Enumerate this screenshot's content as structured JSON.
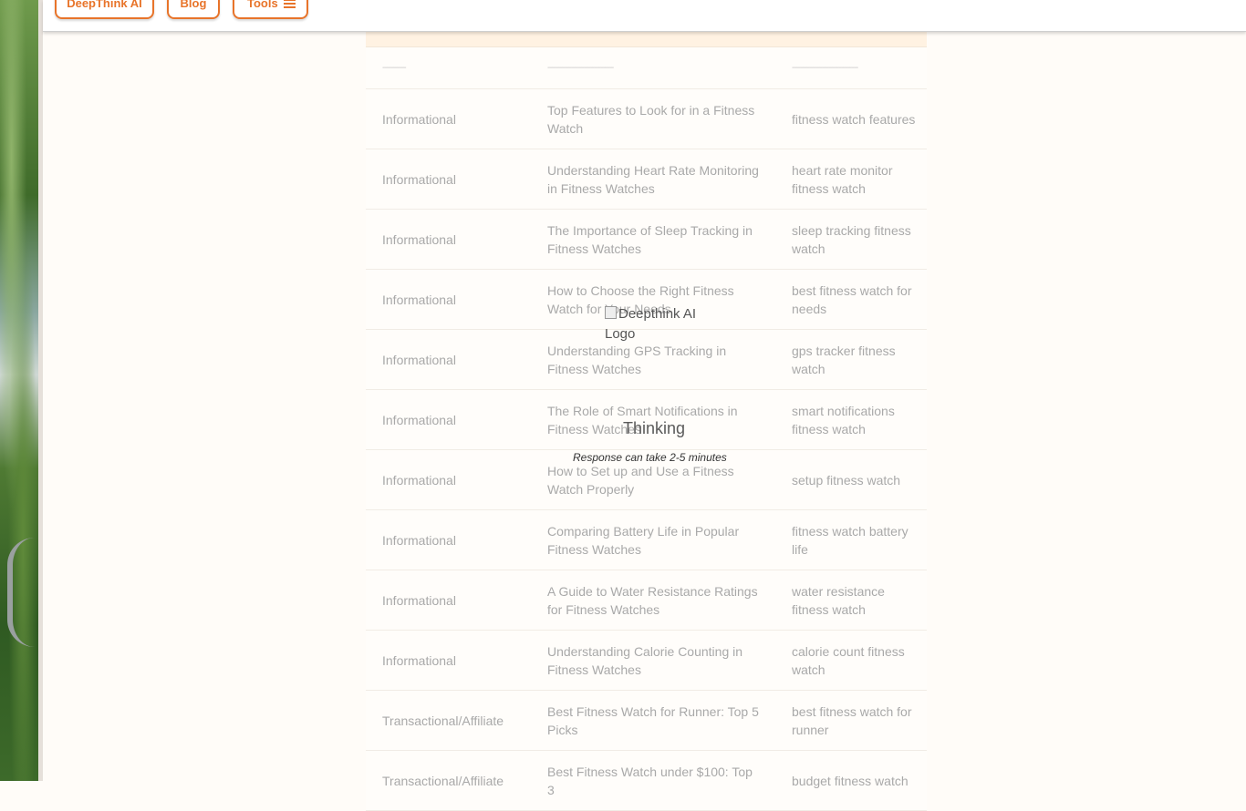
{
  "header": {
    "nav": [
      {
        "label": "DeepThink AI"
      },
      {
        "label": "Blog"
      },
      {
        "label": "Tools",
        "icon": "menu-icon"
      }
    ]
  },
  "table": {
    "separator": [
      "-----------",
      "-------------------------------",
      "-------------------------------"
    ],
    "rows": [
      {
        "type": "Informational",
        "title": "Top Features to Look for in a Fitness Watch",
        "keyword": "fitness watch features"
      },
      {
        "type": "Informational",
        "title": "Understanding Heart Rate Monitoring in Fitness Watches",
        "keyword": "heart rate monitor fitness watch"
      },
      {
        "type": "Informational",
        "title": "The Importance of Sleep Tracking in Fitness Watches",
        "keyword": "sleep tracking fitness watch"
      },
      {
        "type": "Informational",
        "title": "How to Choose the Right Fitness Watch for Your Needs",
        "keyword": "best fitness watch for needs"
      },
      {
        "type": "Informational",
        "title": "Understanding GPS Tracking in Fitness Watches",
        "keyword": "gps tracker fitness watch"
      },
      {
        "type": "Informational",
        "title": "The Role of Smart Notifications in Fitness Watches",
        "keyword": "smart notifications fitness watch"
      },
      {
        "type": "Informational",
        "title": "How to Set up and Use a Fitness Watch Properly",
        "keyword": "setup fitness watch"
      },
      {
        "type": "Informational",
        "title": "Comparing Battery Life in Popular Fitness Watches",
        "keyword": "fitness watch battery life"
      },
      {
        "type": "Informational",
        "title": "A Guide to Water Resistance Ratings for Fitness Watches",
        "keyword": "water resistance fitness watch"
      },
      {
        "type": "Informational",
        "title": "Understanding Calorie Counting in Fitness Watches",
        "keyword": "calorie count fitness watch"
      },
      {
        "type": "Transactional/Affiliate",
        "title": "Best Fitness Watch for Runner: Top 5 Picks",
        "keyword": "best fitness watch for runner"
      },
      {
        "type": "Transactional/Affiliate",
        "title": "Best Fitness Watch under $100: Top 3",
        "keyword": "budget fitness watch"
      }
    ]
  },
  "overlay": {
    "logo_alt": "Deepthink AI Logo",
    "thinking": "Thinking",
    "response_note": "Response can take 2-5 minutes"
  },
  "colors": {
    "accent": "#e8742a",
    "header_strip": "#fff2e2",
    "muted_text": "#a9a9a9"
  }
}
